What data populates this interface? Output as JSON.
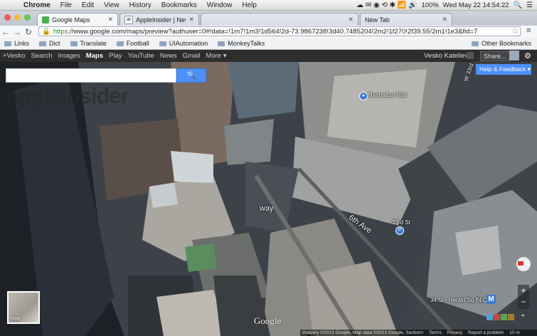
{
  "menubar": {
    "app": "Chrome",
    "items": [
      "File",
      "Edit",
      "View",
      "History",
      "Bookmarks",
      "Window",
      "Help"
    ],
    "battery": "100%",
    "datetime": "Wed May 22  14:54:22"
  },
  "tabs": [
    {
      "title": "Google Maps",
      "active": true
    },
    {
      "title": "AppleInsider | News and ru",
      "active": false
    },
    {
      "title": "",
      "active": false
    },
    {
      "title": "New Tab",
      "active": false
    }
  ],
  "toolbar": {
    "url_scheme": "https",
    "url_rest": "://www.google.com/maps/preview?authuser=0#!data=!1m7!1m3!1d564!2d-73.9867238!3d40.7485204!2m2!1f270!2f39.55!2m1!1e3&fid=7"
  },
  "bookmarks": {
    "items": [
      "Links",
      "Dict",
      "Translate",
      "Football",
      "UIAutomation",
      "MonkeyTalks"
    ],
    "other": "Other Bookmarks"
  },
  "googlebar": {
    "links": [
      "+Vesko",
      "Search",
      "Images",
      "Maps",
      "Play",
      "YouTube",
      "News",
      "Gmail",
      "More ▾"
    ],
    "active": "Maps",
    "user": "Vesko Kateliev",
    "share": "Share..."
  },
  "map": {
    "search_placeholder": "",
    "watermark": "appleinsider",
    "help_feedback": "Help & Feedback",
    "labels": {
      "manhattan_mall": "Manhattan Mall",
      "sixth_ave": "6th Ave",
      "way": "way",
      "w33": "W 33rd",
      "thirty_third": "33rd St",
      "herald_sq": "34 St - Herald Sq [N,Q,R]"
    },
    "thumb_label": "Map",
    "google_logo": "Google",
    "footer": [
      "Imagery ©2013 Google, Map data ©2013 Google, Sanborn",
      "Terms",
      "Privacy",
      "Report a problem",
      "10 m"
    ]
  },
  "colors": {
    "search_button": "#4d90fe",
    "gbar": "#2d2d2d"
  }
}
